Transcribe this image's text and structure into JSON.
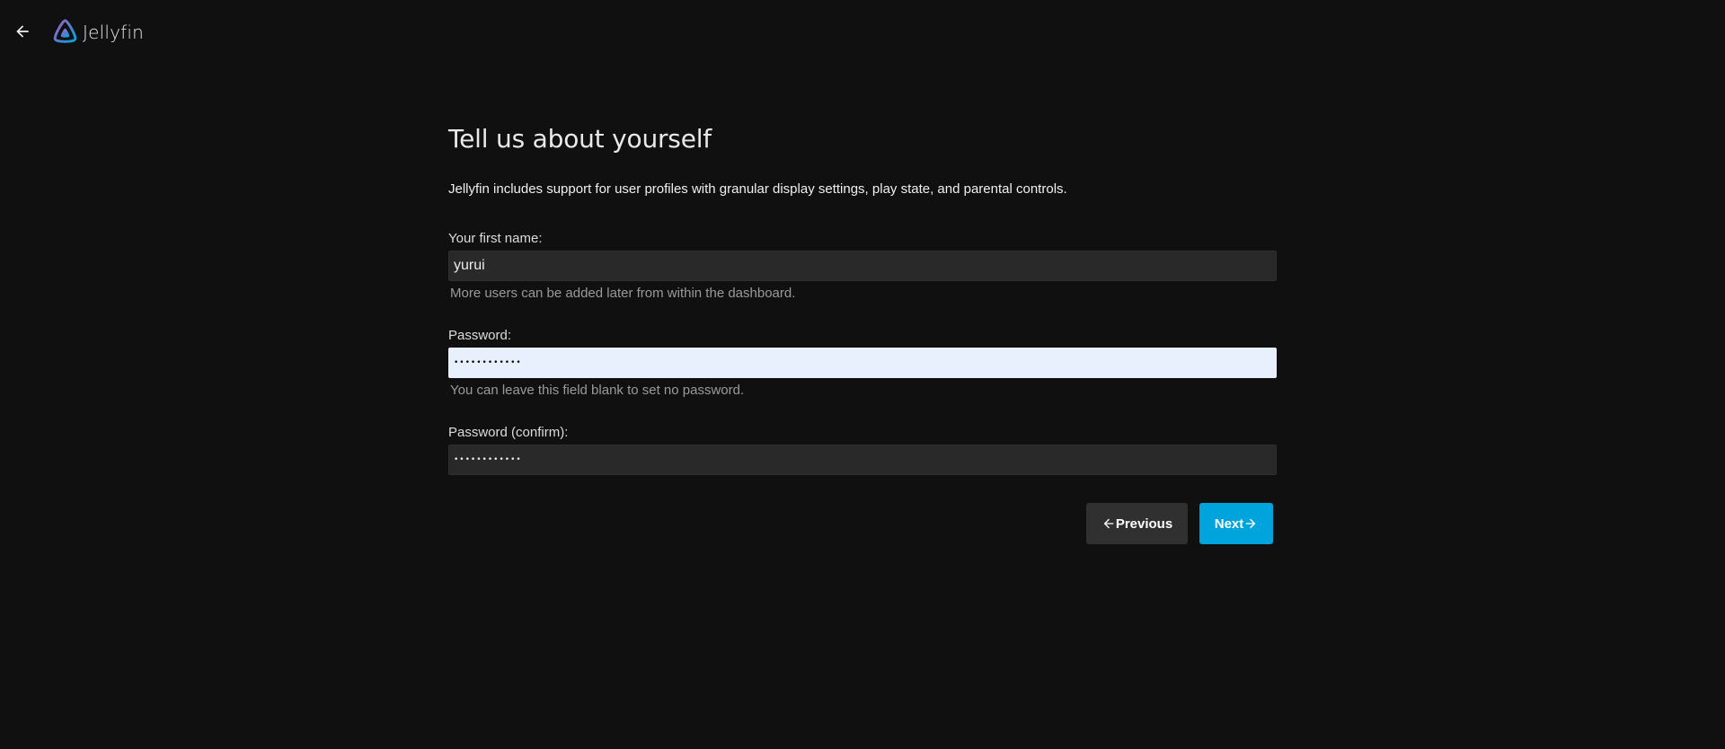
{
  "header": {
    "back_icon": "arrow-left-icon",
    "logo_icon": "jellyfin-logo-icon",
    "app_name": "Jellyfin"
  },
  "page": {
    "title": "Tell us about yourself",
    "intro": "Jellyfin includes support for user profiles with granular display settings, play state, and parental controls."
  },
  "form": {
    "first_name": {
      "label": "Your first name:",
      "value": "yurui",
      "hint": "More users can be added later from within the dashboard."
    },
    "password": {
      "label": "Password:",
      "value": "••••••••••••",
      "hint": "You can leave this field blank to set no password."
    },
    "password_confirm": {
      "label": "Password (confirm):",
      "value": "••••••••••••"
    }
  },
  "buttons": {
    "previous_label": "Previous",
    "previous_icon": "arrow-left-icon",
    "next_label": "Next",
    "next_icon": "arrow-right-icon"
  },
  "colors": {
    "background": "#101010",
    "accent": "#00a4dc",
    "input_bg": "#292929",
    "autofill_bg": "#e8f0fe"
  }
}
